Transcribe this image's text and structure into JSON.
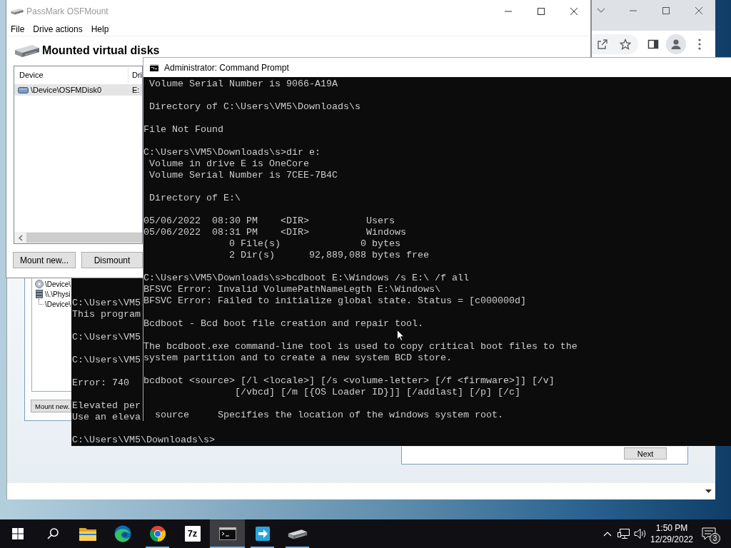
{
  "osfmount_window": {
    "title": "PassMark OSFMount",
    "menu": [
      "File",
      "Drive actions",
      "Help"
    ],
    "heading": "Mounted virtual disks",
    "table": {
      "columns": [
        "Device",
        "Dri"
      ],
      "rows": [
        {
          "cells": [
            "\\Device\\OSFMDisk0",
            "E:"
          ],
          "selected": true
        }
      ]
    },
    "buttons": [
      "Mount new...",
      "Dismount"
    ]
  },
  "mount_dialog": {
    "tree": [
      {
        "kind": "image",
        "label": "\\Device\\"
      },
      {
        "kind": "disk",
        "label": "\\\\.\\Physi",
        "children": [
          {
            "label": "\\Device\\"
          }
        ]
      }
    ],
    "buttons": [
      "Mount new.",
      "Next"
    ]
  },
  "back_console": {
    "blocks": [
      [
        "C:\\Users\\VM5",
        "This program"
      ],
      [
        "C:\\Users\\VM5"
      ],
      [
        "C:\\Users\\VM5"
      ],
      [
        "Error: 740"
      ],
      [
        "Elevated per",
        "Use an eleva"
      ],
      [
        "C:\\Users\\VM5\\Downloads\\s>"
      ]
    ]
  },
  "front_console": {
    "title": "Administrator: Command Prompt",
    "blocks": [
      [
        " Volume Serial Number is 9066-A19A"
      ],
      [
        " Directory of C:\\Users\\VM5\\Downloads\\s"
      ],
      [
        "File Not Found"
      ],
      [
        "C:\\Users\\VM5\\Downloads\\s>dir e:",
        " Volume in drive E is OneCore",
        " Volume Serial Number is 7CEE-7B4C"
      ],
      [
        " Directory of E:\\"
      ],
      [
        "05/06/2022  08:30 PM    <DIR>          Users",
        "05/06/2022  08:31 PM    <DIR>          Windows",
        "               0 File(s)              0 bytes",
        "               2 Dir(s)      92,889,088 bytes free"
      ],
      [
        "C:\\Users\\VM5\\Downloads\\s>bcdboot E:\\Windows /s E:\\ /f all",
        "BFSVC Error: Invalid VolumePathNameLegth E:\\Windows\\",
        "BFSVC Error: Failed to initialize global state. Status = [c000000d]"
      ],
      [
        "Bcdboot - Bcd boot file creation and repair tool."
      ],
      [
        "The bcdboot.exe command-line tool is used to copy critical boot files to the",
        "system partition and to create a new system BCD store."
      ],
      [
        "bcdboot <source> [/l <locale>] [/s <volume-letter> [/f <firmware>]] [/v]",
        "                [/vbcd] [/m [{OS Loader ID}]] [/addlast] [/p] [/c]"
      ],
      [
        "  source     Specifies the location of the windows system root."
      ]
    ]
  },
  "taskbar": {
    "apps": [
      {
        "kind": "folder",
        "running": false,
        "selected": false
      },
      {
        "kind": "edge",
        "running": false,
        "selected": false
      },
      {
        "kind": "chrome",
        "running": true,
        "selected": false
      },
      {
        "kind": "archiver",
        "label": "7z",
        "running": false,
        "selected": false
      },
      {
        "kind": "terminal",
        "running": true,
        "selected": true
      },
      {
        "kind": "transfer",
        "running": true,
        "selected": false
      },
      {
        "kind": "drive",
        "running": true,
        "selected": false
      }
    ],
    "clock": {
      "time": "1:50 PM",
      "date": "12/29/2022"
    },
    "notification_count": "3"
  }
}
